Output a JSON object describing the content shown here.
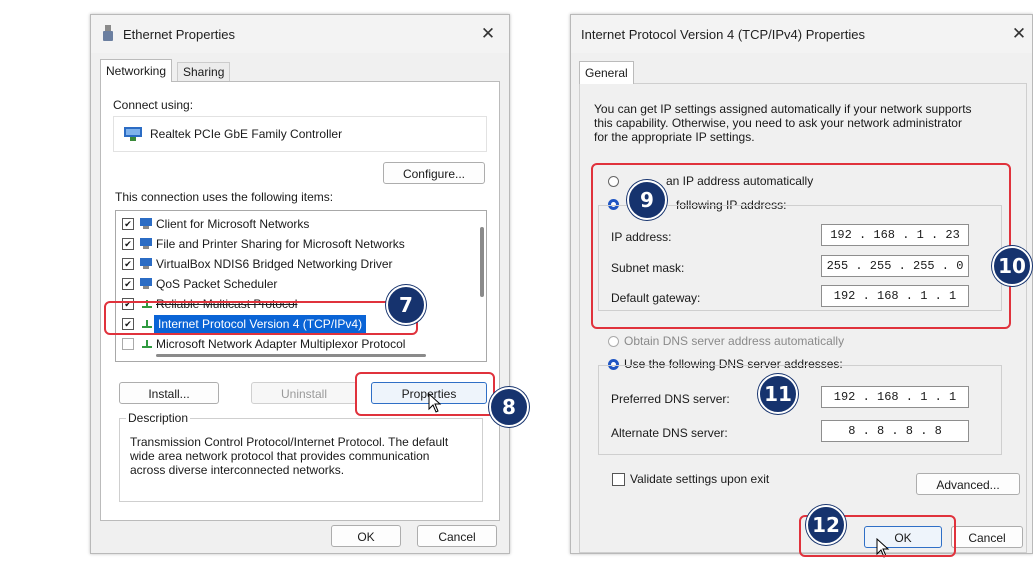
{
  "left_dialog": {
    "title": "Ethernet Properties",
    "close_glyph": "✕",
    "tabs": [
      {
        "label": "Networking",
        "active": true
      },
      {
        "label": "Sharing",
        "active": false
      }
    ],
    "connect_using_label": "Connect using:",
    "adapter_name": "Realtek PCIe GbE Family Controller",
    "configure_button": "Configure...",
    "items_label": "This connection uses the following items:",
    "items": [
      {
        "label": "Client for Microsoft Networks",
        "checked": true
      },
      {
        "label": "File and Printer Sharing for Microsoft Networks",
        "checked": true
      },
      {
        "label": "VirtualBox NDIS6 Bridged Networking Driver",
        "checked": true
      },
      {
        "label": "QoS Packet Scheduler",
        "checked": true
      },
      {
        "label": "Reliable Multicast Protocol",
        "checked": true
      },
      {
        "label": "Internet Protocol Version 4 (TCP/IPv4)",
        "checked": true,
        "selected": true
      },
      {
        "label": "Microsoft Network Adapter Multiplexor Protocol",
        "checked": false
      }
    ],
    "install_button": "Install...",
    "uninstall_button": "Uninstall",
    "properties_button": "Properties",
    "description_caption": "Description",
    "description_lines": [
      "Transmission Control Protocol/Internet Protocol. The default",
      "wide area network protocol that provides communication",
      "across diverse interconnected networks."
    ],
    "ok_button": "OK",
    "cancel_button": "Cancel"
  },
  "right_dialog": {
    "title": "Internet Protocol Version 4 (TCP/IPv4) Properties",
    "close_glyph": "✕",
    "tabs": [
      {
        "label": "General",
        "active": true
      }
    ],
    "intro_lines": [
      "You can get IP settings assigned automatically if your network supports",
      "this capability. Otherwise, you need to ask your network administrator",
      "for the appropriate IP settings."
    ],
    "radio_obtain_ip": {
      "label": "an IP address automatically",
      "selected": false
    },
    "radio_use_ip": {
      "label": "following IP address:",
      "selected": true
    },
    "ip_address_label": "IP address:",
    "ip_address_value": "192 . 168 .  1  . 23",
    "subnet_label": "Subnet mask:",
    "subnet_value": "255 . 255 . 255 .  0",
    "gateway_label": "Default gateway:",
    "gateway_value": "192 . 168 .  1  .  1",
    "radio_obtain_dns": {
      "label": "Obtain DNS server address automatically",
      "selected": false
    },
    "radio_use_dns": {
      "label": "Use the following DNS server addresses:",
      "selected": true
    },
    "preferred_dns_label": "Preferred DNS server:",
    "preferred_dns_value": "192 . 168 .  1  .  1",
    "alternate_dns_label": "Alternate DNS server:",
    "alternate_dns_value": "8  .  8  .  8  .  8",
    "validate_label": "Validate settings upon exit",
    "validate_checked": false,
    "advanced_button": "Advanced...",
    "ok_button": "OK",
    "cancel_button": "Cancel"
  },
  "step_badges": [
    "7",
    "8",
    "9",
    "10",
    "11",
    "12"
  ],
  "colors": {
    "badge": "#16336e",
    "highlight_box": "#e0323c",
    "selection": "#0a64d6"
  }
}
